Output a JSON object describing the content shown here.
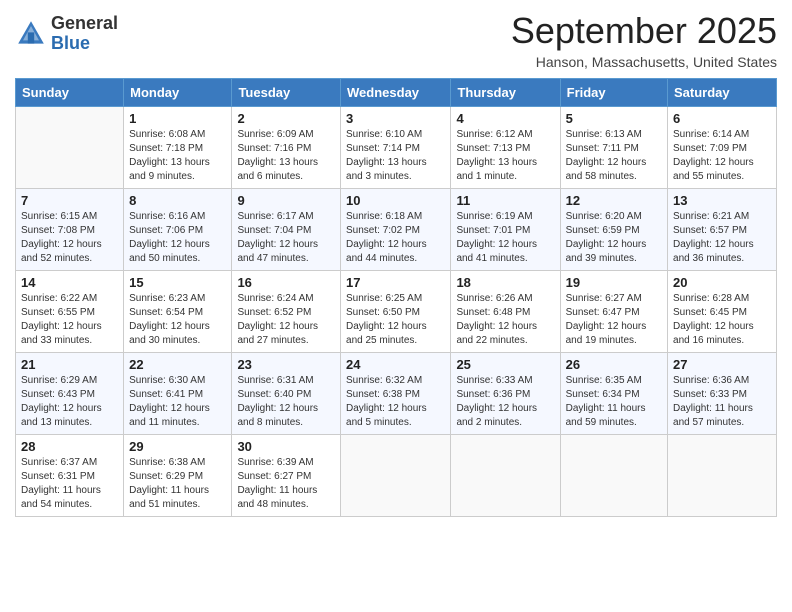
{
  "header": {
    "logo": {
      "general": "General",
      "blue": "Blue"
    },
    "title": "September 2025",
    "location": "Hanson, Massachusetts, United States"
  },
  "days_of_week": [
    "Sunday",
    "Monday",
    "Tuesday",
    "Wednesday",
    "Thursday",
    "Friday",
    "Saturday"
  ],
  "weeks": [
    [
      {
        "day": "",
        "info": ""
      },
      {
        "day": "1",
        "info": "Sunrise: 6:08 AM\nSunset: 7:18 PM\nDaylight: 13 hours\nand 9 minutes."
      },
      {
        "day": "2",
        "info": "Sunrise: 6:09 AM\nSunset: 7:16 PM\nDaylight: 13 hours\nand 6 minutes."
      },
      {
        "day": "3",
        "info": "Sunrise: 6:10 AM\nSunset: 7:14 PM\nDaylight: 13 hours\nand 3 minutes."
      },
      {
        "day": "4",
        "info": "Sunrise: 6:12 AM\nSunset: 7:13 PM\nDaylight: 13 hours\nand 1 minute."
      },
      {
        "day": "5",
        "info": "Sunrise: 6:13 AM\nSunset: 7:11 PM\nDaylight: 12 hours\nand 58 minutes."
      },
      {
        "day": "6",
        "info": "Sunrise: 6:14 AM\nSunset: 7:09 PM\nDaylight: 12 hours\nand 55 minutes."
      }
    ],
    [
      {
        "day": "7",
        "info": "Sunrise: 6:15 AM\nSunset: 7:08 PM\nDaylight: 12 hours\nand 52 minutes."
      },
      {
        "day": "8",
        "info": "Sunrise: 6:16 AM\nSunset: 7:06 PM\nDaylight: 12 hours\nand 50 minutes."
      },
      {
        "day": "9",
        "info": "Sunrise: 6:17 AM\nSunset: 7:04 PM\nDaylight: 12 hours\nand 47 minutes."
      },
      {
        "day": "10",
        "info": "Sunrise: 6:18 AM\nSunset: 7:02 PM\nDaylight: 12 hours\nand 44 minutes."
      },
      {
        "day": "11",
        "info": "Sunrise: 6:19 AM\nSunset: 7:01 PM\nDaylight: 12 hours\nand 41 minutes."
      },
      {
        "day": "12",
        "info": "Sunrise: 6:20 AM\nSunset: 6:59 PM\nDaylight: 12 hours\nand 39 minutes."
      },
      {
        "day": "13",
        "info": "Sunrise: 6:21 AM\nSunset: 6:57 PM\nDaylight: 12 hours\nand 36 minutes."
      }
    ],
    [
      {
        "day": "14",
        "info": "Sunrise: 6:22 AM\nSunset: 6:55 PM\nDaylight: 12 hours\nand 33 minutes."
      },
      {
        "day": "15",
        "info": "Sunrise: 6:23 AM\nSunset: 6:54 PM\nDaylight: 12 hours\nand 30 minutes."
      },
      {
        "day": "16",
        "info": "Sunrise: 6:24 AM\nSunset: 6:52 PM\nDaylight: 12 hours\nand 27 minutes."
      },
      {
        "day": "17",
        "info": "Sunrise: 6:25 AM\nSunset: 6:50 PM\nDaylight: 12 hours\nand 25 minutes."
      },
      {
        "day": "18",
        "info": "Sunrise: 6:26 AM\nSunset: 6:48 PM\nDaylight: 12 hours\nand 22 minutes."
      },
      {
        "day": "19",
        "info": "Sunrise: 6:27 AM\nSunset: 6:47 PM\nDaylight: 12 hours\nand 19 minutes."
      },
      {
        "day": "20",
        "info": "Sunrise: 6:28 AM\nSunset: 6:45 PM\nDaylight: 12 hours\nand 16 minutes."
      }
    ],
    [
      {
        "day": "21",
        "info": "Sunrise: 6:29 AM\nSunset: 6:43 PM\nDaylight: 12 hours\nand 13 minutes."
      },
      {
        "day": "22",
        "info": "Sunrise: 6:30 AM\nSunset: 6:41 PM\nDaylight: 12 hours\nand 11 minutes."
      },
      {
        "day": "23",
        "info": "Sunrise: 6:31 AM\nSunset: 6:40 PM\nDaylight: 12 hours\nand 8 minutes."
      },
      {
        "day": "24",
        "info": "Sunrise: 6:32 AM\nSunset: 6:38 PM\nDaylight: 12 hours\nand 5 minutes."
      },
      {
        "day": "25",
        "info": "Sunrise: 6:33 AM\nSunset: 6:36 PM\nDaylight: 12 hours\nand 2 minutes."
      },
      {
        "day": "26",
        "info": "Sunrise: 6:35 AM\nSunset: 6:34 PM\nDaylight: 11 hours\nand 59 minutes."
      },
      {
        "day": "27",
        "info": "Sunrise: 6:36 AM\nSunset: 6:33 PM\nDaylight: 11 hours\nand 57 minutes."
      }
    ],
    [
      {
        "day": "28",
        "info": "Sunrise: 6:37 AM\nSunset: 6:31 PM\nDaylight: 11 hours\nand 54 minutes."
      },
      {
        "day": "29",
        "info": "Sunrise: 6:38 AM\nSunset: 6:29 PM\nDaylight: 11 hours\nand 51 minutes."
      },
      {
        "day": "30",
        "info": "Sunrise: 6:39 AM\nSunset: 6:27 PM\nDaylight: 11 hours\nand 48 minutes."
      },
      {
        "day": "",
        "info": ""
      },
      {
        "day": "",
        "info": ""
      },
      {
        "day": "",
        "info": ""
      },
      {
        "day": "",
        "info": ""
      }
    ]
  ]
}
